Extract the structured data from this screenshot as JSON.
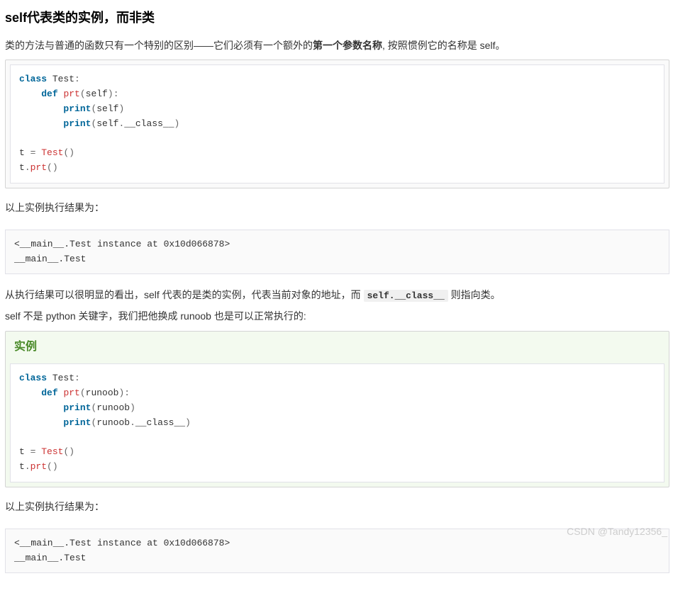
{
  "heading": "self代表类的实例，而非类",
  "para1_prefix": "类的方法与普通的函数只有一个特别的区别——它们必须有一个额外的",
  "para1_bold": "第一个参数名称",
  "para1_suffix": ", 按照惯例它的名称是 self。",
  "code1": {
    "tokens": [
      {
        "t": "class",
        "c": "kw"
      },
      {
        "t": " "
      },
      {
        "t": "Test"
      },
      {
        "t": ":",
        "c": "pn"
      },
      {
        "nl": true
      },
      {
        "t": "    "
      },
      {
        "t": "def",
        "c": "kw"
      },
      {
        "t": " "
      },
      {
        "t": "prt",
        "c": "fn"
      },
      {
        "t": "(",
        "c": "pn"
      },
      {
        "t": "self"
      },
      {
        "t": ")",
        "c": "pn"
      },
      {
        "t": ":",
        "c": "pn"
      },
      {
        "nl": true
      },
      {
        "t": "        "
      },
      {
        "t": "print",
        "c": "kw"
      },
      {
        "t": "(",
        "c": "pn"
      },
      {
        "t": "self"
      },
      {
        "t": ")",
        "c": "pn"
      },
      {
        "nl": true
      },
      {
        "t": "        "
      },
      {
        "t": "print",
        "c": "kw"
      },
      {
        "t": "(",
        "c": "pn"
      },
      {
        "t": "self"
      },
      {
        "t": ".",
        "c": "pn"
      },
      {
        "t": "__class__"
      },
      {
        "t": ")",
        "c": "pn"
      },
      {
        "nl": true
      },
      {
        "nl": true
      },
      {
        "t": "t "
      },
      {
        "t": "=",
        "c": "op"
      },
      {
        "t": " "
      },
      {
        "t": "Test",
        "c": "fn"
      },
      {
        "t": "(",
        "c": "pn"
      },
      {
        "t": ")",
        "c": "pn"
      },
      {
        "nl": true
      },
      {
        "t": "t"
      },
      {
        "t": ".",
        "c": "pn"
      },
      {
        "t": "prt",
        "c": "fn"
      },
      {
        "t": "(",
        "c": "pn"
      },
      {
        "t": ")",
        "c": "pn"
      }
    ]
  },
  "result_label1": "以上实例执行结果为：",
  "output1": "<__main__.Test instance at 0x10d066878>\n__main__.Test",
  "para2_prefix": "从执行结果可以很明显的看出，self 代表的是类的实例，代表当前对象的地址，而 ",
  "para2_code": "self.__class__",
  "para2_suffix": " 则指向类。",
  "para3": "self 不是 python 关键字，我们把他换成 runoob 也是可以正常执行的:",
  "example_title": "实例",
  "code2": {
    "tokens": [
      {
        "t": "class",
        "c": "kw"
      },
      {
        "t": " "
      },
      {
        "t": "Test"
      },
      {
        "t": ":",
        "c": "pn"
      },
      {
        "nl": true
      },
      {
        "t": "    "
      },
      {
        "t": "def",
        "c": "kw"
      },
      {
        "t": " "
      },
      {
        "t": "prt",
        "c": "fn"
      },
      {
        "t": "(",
        "c": "pn"
      },
      {
        "t": "runoob"
      },
      {
        "t": ")",
        "c": "pn"
      },
      {
        "t": ":",
        "c": "pn"
      },
      {
        "nl": true
      },
      {
        "t": "        "
      },
      {
        "t": "print",
        "c": "kw"
      },
      {
        "t": "(",
        "c": "pn"
      },
      {
        "t": "runoob"
      },
      {
        "t": ")",
        "c": "pn"
      },
      {
        "nl": true
      },
      {
        "t": "        "
      },
      {
        "t": "print",
        "c": "kw"
      },
      {
        "t": "(",
        "c": "pn"
      },
      {
        "t": "runoob"
      },
      {
        "t": ".",
        "c": "pn"
      },
      {
        "t": "__class__"
      },
      {
        "t": ")",
        "c": "pn"
      },
      {
        "nl": true
      },
      {
        "nl": true
      },
      {
        "t": "t "
      },
      {
        "t": "=",
        "c": "op"
      },
      {
        "t": " "
      },
      {
        "t": "Test",
        "c": "fn"
      },
      {
        "t": "(",
        "c": "pn"
      },
      {
        "t": ")",
        "c": "pn"
      },
      {
        "nl": true
      },
      {
        "t": "t"
      },
      {
        "t": ".",
        "c": "pn"
      },
      {
        "t": "prt",
        "c": "fn"
      },
      {
        "t": "(",
        "c": "pn"
      },
      {
        "t": ")",
        "c": "pn"
      }
    ]
  },
  "result_label2": "以上实例执行结果为：",
  "output2": "<__main__.Test instance at 0x10d066878>\n__main__.Test",
  "watermark": "CSDN @Tandy12356_"
}
